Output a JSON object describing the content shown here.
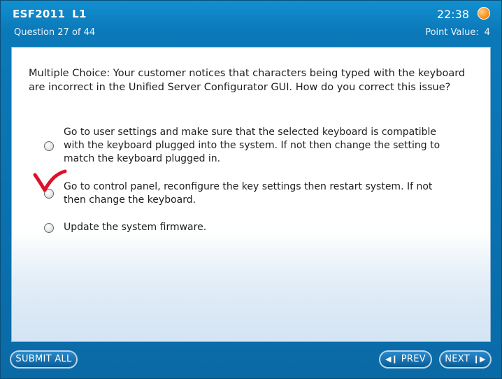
{
  "header": {
    "course": "ESF2011",
    "level": "L1",
    "time": "22:38",
    "question_progress": "Question 27 of 44",
    "point_value_label": "Point Value:",
    "point_value": "4"
  },
  "question": {
    "text": "Multiple Choice:  Your customer notices that characters being typed with the keyboard are incorrect in the Unified Server Configurator GUI. How do you correct this issue?",
    "options": [
      {
        "label": "Go to user settings and make sure that the selected keyboard is compatible with the keyboard plugged into the system. If not then change the setting to match the keyboard plugged in.",
        "selected": false
      },
      {
        "label": "Go to control panel, reconfigure the key settings then restart system. If not then change the keyboard.",
        "selected": false,
        "annotated_checkmark": true
      },
      {
        "label": "Update the system firmware.",
        "selected": false
      }
    ]
  },
  "footer": {
    "submit_label": "SUBMIT ALL",
    "prev_label": "PREV",
    "next_label": "NEXT"
  },
  "colors": {
    "frame_blue": "#0a74b2",
    "timer_orange": "#f6921e",
    "checkmark_red": "#e0102a"
  },
  "icons": {
    "timer": "timer-icon",
    "prev": "prev-icon",
    "next": "next-icon",
    "annotation": "checkmark-annotation"
  }
}
